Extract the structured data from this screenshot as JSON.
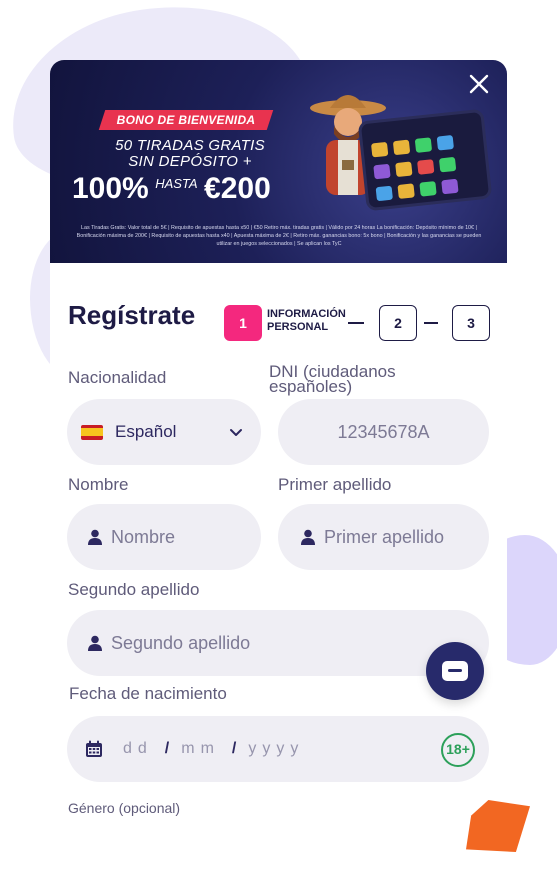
{
  "banner": {
    "ribbon": "BONO DE BIENVENIDA",
    "line1": "50 TIRADAS GRATIS",
    "line2": "SIN DEPÓSITO +",
    "percent": "100%",
    "hasta": "HASTA",
    "amount": "€200",
    "terms": "Las Tiradas Gratis: Valor total de 5€ | Requisito de apuestas hasta x50 | €50 Retiro máx. tiradas gratis | Válido por 24 horas La bonificación: Depósito mínimo de 10€ | Bonificación máxima de 200€ | Requisito de apuestas hasta x40 | Apuesta máxima de 2€ | Retiro máx. ganancias bono: 5x bono | Bonificación y las ganancias se pueden utilizar en juegos seleccionados | Se aplican los TyC"
  },
  "header": {
    "title": "Regístrate",
    "steps": [
      {
        "number": "1",
        "label_line1": "INFORMACIÓN",
        "label_line2": "PERSONAL"
      },
      {
        "number": "2"
      },
      {
        "number": "3"
      }
    ]
  },
  "form": {
    "nationality": {
      "label": "Nacionalidad",
      "value": "Español"
    },
    "dni": {
      "label_line1": "DNI (ciudadanos",
      "label_line2": "españoles)",
      "placeholder": "12345678A"
    },
    "first_name": {
      "label": "Nombre",
      "placeholder": "Nombre"
    },
    "last_name1": {
      "label": "Primer apellido",
      "placeholder": "Primer apellido"
    },
    "last_name2": {
      "label": "Segundo apellido",
      "placeholder": "Segundo apellido"
    },
    "birth_date": {
      "label": "Fecha de nacimiento",
      "day": "dd",
      "month": "mm",
      "year": "yyyy",
      "sep": "/",
      "age_badge": "18+"
    },
    "gender": {
      "label": "Género (opcional)"
    }
  },
  "colors": {
    "accent": "#f4287e",
    "navy": "#1e1b45",
    "field_bg": "#efeef4",
    "badge_green": "#2ca05a",
    "chat_bg": "#272a6b"
  }
}
